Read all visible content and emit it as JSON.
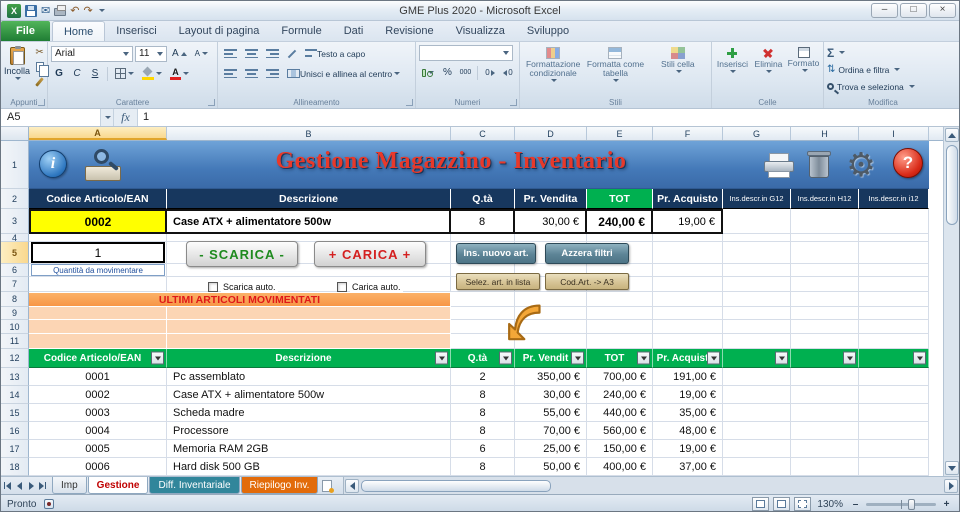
{
  "colors": {
    "banner_blue": "#4a7ebb",
    "header_navy": "#17375e",
    "green": "#00b050",
    "selected_yellow": "#ffff00",
    "orange_banner": "#f79646",
    "orange_light": "#fcd5b4",
    "title_red": "#e8392a",
    "file_tab_green": "#1f7d34",
    "tab_teal": "#31869b",
    "tab_orange": "#e26b0a"
  },
  "window": {
    "title": "GME Plus 2020 - Microsoft Excel",
    "minimize": "–",
    "maximize": "□",
    "close": "×"
  },
  "ribbon": {
    "tabs": [
      "File",
      "Home",
      "Inserisci",
      "Layout di pagina",
      "Formule",
      "Dati",
      "Revisione",
      "Visualizza",
      "Sviluppo"
    ],
    "clipboard": {
      "label": "Appunti",
      "paste": "Incolla"
    },
    "font": {
      "label": "Carattere",
      "name": "Arial",
      "size": "11",
      "bold": "G",
      "italic": "C",
      "underline": "S",
      "letter": "A"
    },
    "alignment": {
      "label": "Allineamento",
      "wrap": "Testo a capo",
      "merge": "Unisci e allinea al centro"
    },
    "number": {
      "label": "Numeri",
      "percent": "%",
      "thousands": "000",
      "zero": "0"
    },
    "styles": {
      "label": "Stili",
      "conditional": "Formattazione condizionale",
      "as_table": "Formatta come tabella",
      "cell_styles": "Stili cella"
    },
    "cells": {
      "label": "Celle",
      "insert": "Inserisci",
      "delete": "Elimina",
      "format": "Formato"
    },
    "editing": {
      "label": "Modifica",
      "sum": "Σ",
      "sort": "Ordina e filtra",
      "find": "Trova e seleziona"
    }
  },
  "formula_bar": {
    "name_box": "A5",
    "fx": "fx",
    "value": "1"
  },
  "grid": {
    "columns": [
      "A",
      "B",
      "C",
      "D",
      "E",
      "F",
      "G",
      "H",
      "I"
    ],
    "rows": [
      "1",
      "2",
      "3",
      "4",
      "5",
      "6",
      "7",
      "8",
      "9",
      "10",
      "11",
      "12",
      "13",
      "14",
      "15",
      "16",
      "17",
      "18"
    ]
  },
  "banner": {
    "title": "Gestione Magazzino - Inventario",
    "info": "i",
    "help": "?",
    "gear": "⚙"
  },
  "detail": {
    "headers": [
      "Codice Articolo/EAN",
      "Descrizione",
      "Q.tà",
      "Pr. Vendita",
      "TOT",
      "Pr. Acquisto",
      "Ins.descr.in G12",
      "Ins.descr.in H12",
      "Ins.descr.in i12"
    ],
    "code": "0002",
    "description": "Case ATX + alimentatore 500w",
    "qty": "8",
    "sell": "30,00 €",
    "total": "240,00 €",
    "buy": "19,00 €"
  },
  "controls": {
    "qty_value": "1",
    "qty_label": "Quantità da movimentare",
    "scarica": "- SCARICA -",
    "carica": "+ CARICA +",
    "ins_nuovo": "Ins. nuovo art.",
    "azzera_filtri": "Azzera filtri",
    "scarica_auto": "Scarica auto.",
    "carica_auto": "Carica auto.",
    "selez_lista": "Selez. art. in lista",
    "codart_a3": "Cod.Art. -> A3",
    "moved_banner": "ULTIMI ARTICOLI MOVIMENTATI"
  },
  "inventory": {
    "headers": [
      "Codice Articolo/EAN",
      "Descrizione",
      "Q.tà",
      "Pr. Vendit",
      "TOT",
      "Pr. Acquist"
    ],
    "rows": [
      [
        "0001",
        "Pc assemblato",
        "2",
        "350,00 €",
        "700,00 €",
        "191,00 €"
      ],
      [
        "0002",
        "Case ATX + alimentatore 500w",
        "8",
        "30,00 €",
        "240,00 €",
        "19,00 €"
      ],
      [
        "0003",
        "Scheda madre",
        "8",
        "55,00 €",
        "440,00 €",
        "35,00 €"
      ],
      [
        "0004",
        "Processore",
        "8",
        "70,00 €",
        "560,00 €",
        "48,00 €"
      ],
      [
        "0005",
        "Memoria RAM 2GB",
        "6",
        "25,00 €",
        "150,00 €",
        "19,00 €"
      ],
      [
        "0006",
        "Hard disk 500 GB",
        "8",
        "50,00 €",
        "400,00 €",
        "37,00 €"
      ]
    ]
  },
  "sheet_tabs": {
    "tabs": [
      "Imp",
      "Gestione",
      "Diff. Inventariale",
      "Riepilogo Inv."
    ]
  },
  "status": {
    "ready": "Pronto",
    "zoom": "130%",
    "zoom_out": "–",
    "zoom_in": "+"
  },
  "glyphs": {
    "cut": "✂",
    "undo": "↶",
    "redo": "↷",
    "mail": "✉",
    "logo": "X"
  }
}
